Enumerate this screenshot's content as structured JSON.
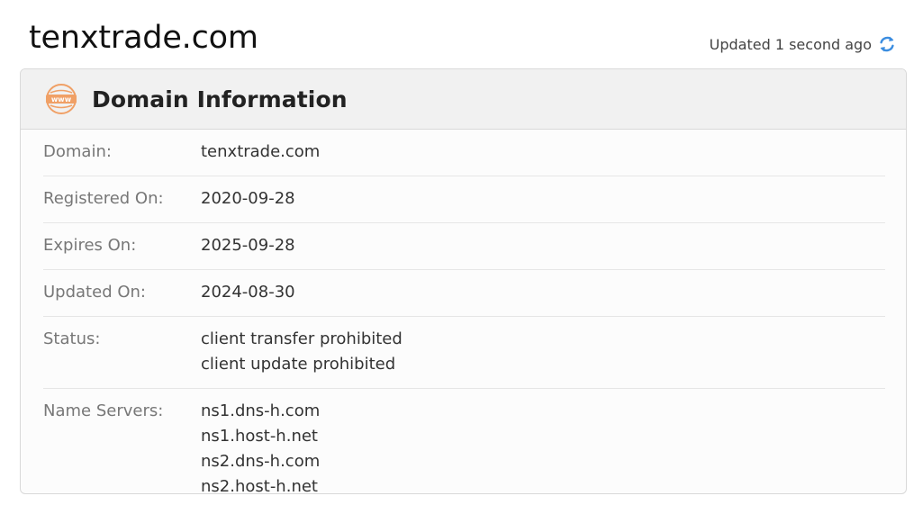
{
  "page": {
    "title": "tenxtrade.com",
    "updated_text": "Updated 1 second ago"
  },
  "card": {
    "title": "Domain Information",
    "icon": "www-globe-icon",
    "rows": [
      {
        "label": "Domain:",
        "values": [
          "tenxtrade.com"
        ]
      },
      {
        "label": "Registered On:",
        "values": [
          "2020-09-28"
        ]
      },
      {
        "label": "Expires On:",
        "values": [
          "2025-09-28"
        ]
      },
      {
        "label": "Updated On:",
        "values": [
          "2024-08-30"
        ]
      },
      {
        "label": "Status:",
        "values": [
          "client transfer prohibited",
          "client update prohibited"
        ]
      },
      {
        "label": "Name Servers:",
        "values": [
          "ns1.dns-h.com",
          "ns1.host-h.net",
          "ns2.dns-h.com",
          "ns2.host-h.net"
        ]
      }
    ]
  },
  "colors": {
    "accent_orange": "#f0a066",
    "refresh_blue": "#3b8de0"
  }
}
